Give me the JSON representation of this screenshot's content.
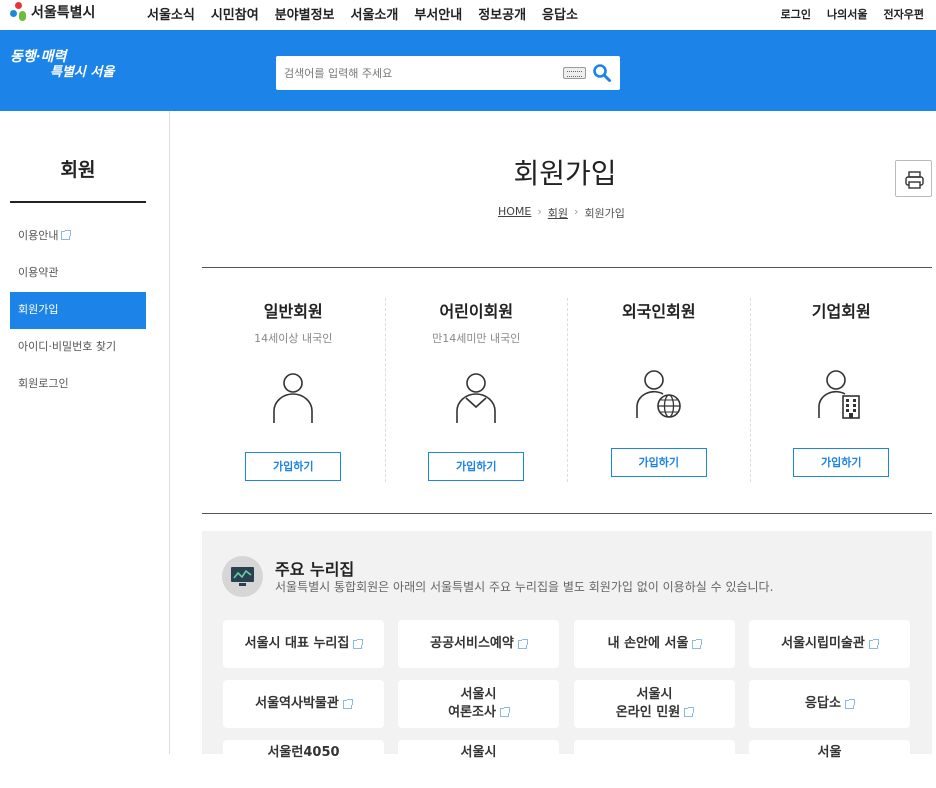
{
  "top": {
    "logo_text": "서울특별시",
    "nav": [
      "서울소식",
      "시민참여",
      "분야별정보",
      "서울소개",
      "부서안내",
      "정보공개",
      "응답소"
    ],
    "util": [
      "로그인",
      "나의서울",
      "전자우편"
    ]
  },
  "header": {
    "slogan_line1": "동행·매력",
    "slogan_line2": "특별시 서울",
    "search_placeholder": "검색어를 입력해 주세요"
  },
  "sidebar": {
    "title": "회원",
    "items": [
      {
        "label": "이용안내",
        "external": true
      },
      {
        "label": "이용약관"
      },
      {
        "label": "회원가입",
        "active": true
      },
      {
        "label": "아이디·비밀번호 찾기"
      },
      {
        "label": "회원로그인"
      }
    ]
  },
  "main": {
    "title": "회원가입",
    "breadcrumb": [
      "HOME",
      "회원",
      "회원가입"
    ],
    "types": [
      {
        "name": "일반회원",
        "sub": "14세이상 내국인",
        "button": "가입하기",
        "icon": "person-icon"
      },
      {
        "name": "어린이회원",
        "sub": "만14세미만 내국인",
        "button": "가입하기",
        "icon": "child-icon"
      },
      {
        "name": "외국인회원",
        "sub": "",
        "button": "가입하기",
        "icon": "foreigner-globe-icon"
      },
      {
        "name": "기업회원",
        "sub": "",
        "button": "가입하기",
        "icon": "business-building-icon"
      }
    ]
  },
  "portal": {
    "title": "주요 누리집",
    "desc": "서울특별시 통합회원은 아래의 서울특별시 주요 누리집을 별도 회원가입 없이 이용하실 수 있습니다.",
    "sites": [
      {
        "l1": "서울시 대표 누리집",
        "l2": ""
      },
      {
        "l1": "공공서비스예약",
        "l2": ""
      },
      {
        "l1": "내 손안에 서울",
        "l2": ""
      },
      {
        "l1": "서울시립미술관",
        "l2": ""
      },
      {
        "l1": "서울역사박물관",
        "l2": ""
      },
      {
        "l1": "서울시",
        "l2": "여론조사"
      },
      {
        "l1": "서울시",
        "l2": "온라인 민원"
      },
      {
        "l1": "응답소",
        "l2": ""
      },
      {
        "l1": "서울런4050",
        "l2": ""
      },
      {
        "l1": "서울시",
        "l2": ""
      },
      {
        "l1": "",
        "l2": ""
      },
      {
        "l1": "서울",
        "l2": ""
      }
    ]
  },
  "colors": {
    "brand": "#1c83e8",
    "text": "#222222"
  }
}
